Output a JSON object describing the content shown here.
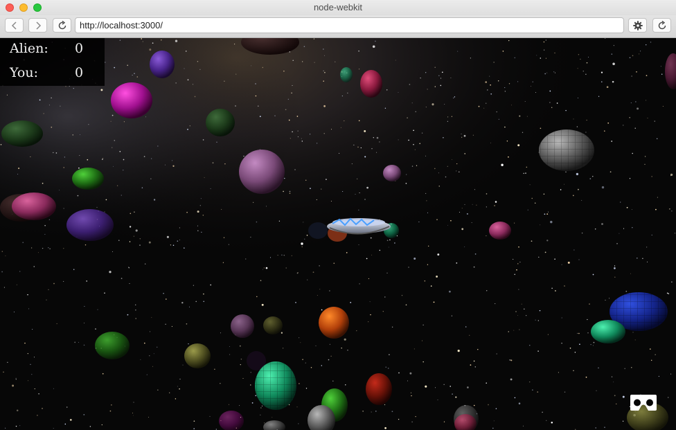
{
  "window": {
    "title": "node-webkit"
  },
  "toolbar": {
    "back_icon": "chevron-left-icon",
    "forward_icon": "chevron-right-icon",
    "reload_icon": "reload-icon",
    "url": "http://localhost:3000/",
    "settings_icon": "gear-icon",
    "right_reload_icon": "reload-icon"
  },
  "scoreboard": {
    "alien_label": "Alien:",
    "alien_score": "0",
    "you_label": "You:",
    "you_score": "0"
  },
  "vr": {
    "icon": "vr-headset-icon"
  },
  "colors": {
    "background": "#000000",
    "scoreboard_bg": "#000000",
    "score_text": "#f2f2f2"
  }
}
